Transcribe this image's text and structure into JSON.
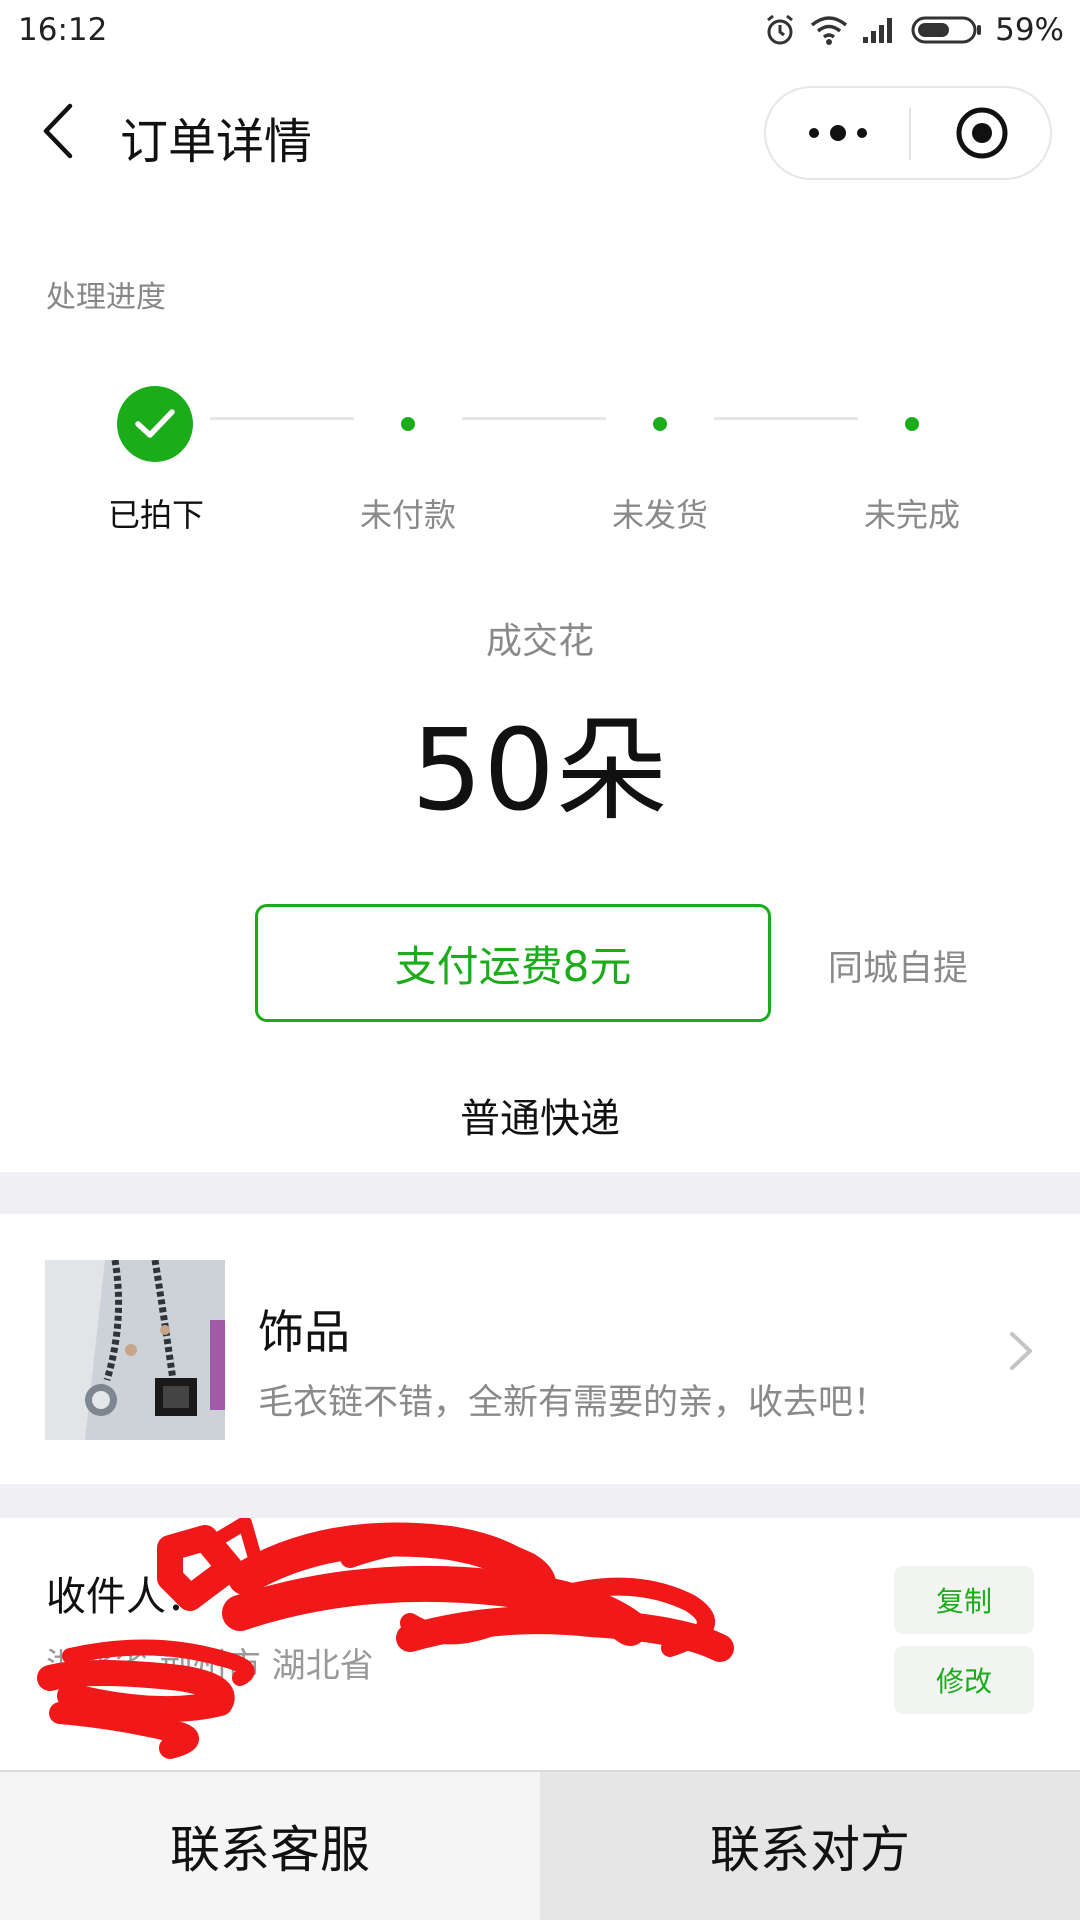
{
  "status_bar": {
    "time": "16:12",
    "battery_percent": "59%",
    "icons": [
      "alarm-icon",
      "wifi-icon",
      "signal-icon",
      "battery-icon"
    ],
    "battery_level": 0.59
  },
  "header": {
    "title": "订单详情",
    "back_icon": "chevron-left-icon",
    "more_icon": "more-dots-icon",
    "close_icon": "target-close-icon"
  },
  "progress": {
    "heading": "处理进度",
    "steps": [
      {
        "label": "已拍下",
        "done": true
      },
      {
        "label": "未付款",
        "done": false
      },
      {
        "label": "未发货",
        "done": false
      },
      {
        "label": "未完成",
        "done": false
      }
    ]
  },
  "deal": {
    "label": "成交花",
    "value": "50朵"
  },
  "shipping": {
    "pay_button_label": "支付运费8元",
    "pickup_label": "同城自提",
    "express_type": "普通快递"
  },
  "product": {
    "name": "饰品",
    "description": "毛衣链不错，全新有需要的亲，收去吧！"
  },
  "address": {
    "receiver_label": "收件人：",
    "address_text": "湖北省 荆州市 湖北省",
    "copy_label": "复制",
    "edit_label": "修改"
  },
  "bottom": {
    "contact_service": "联系客服",
    "contact_other": "联系对方"
  },
  "colors": {
    "accent_green": "#1aad19",
    "redaction_red": "#f01818",
    "band_gray": "#efeff4"
  }
}
